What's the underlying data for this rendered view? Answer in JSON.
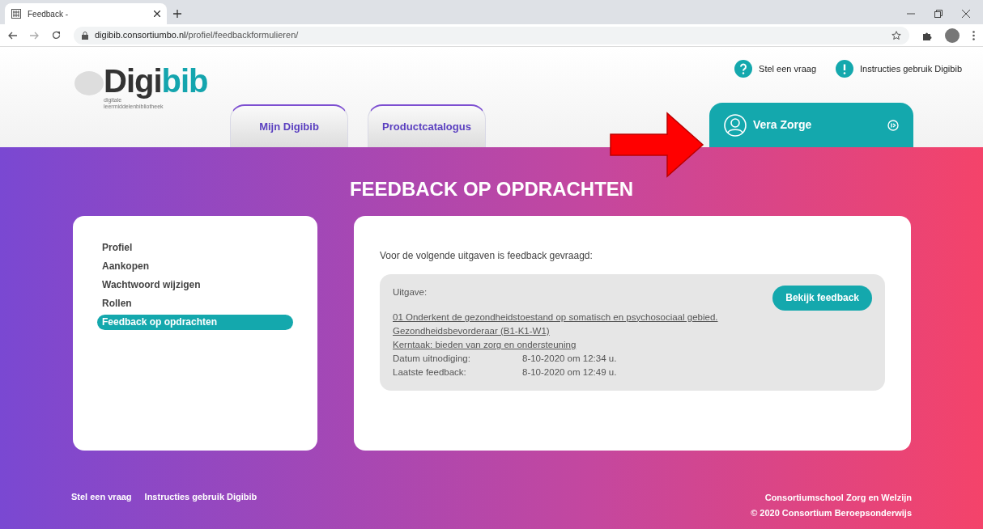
{
  "browser": {
    "tab_title": "Feedback -",
    "url_host": "digibib.consortiumbo.nl",
    "url_path": "/profiel/feedbackformulieren/"
  },
  "header": {
    "logo": {
      "dark": "Digi",
      "accent": "bib",
      "subtitle_1": "digitale",
      "subtitle_2": "leermiddelenbibliotheek"
    },
    "top_links": [
      {
        "kind": "question",
        "label": "Stel een vraag"
      },
      {
        "kind": "info",
        "label": "Instructies gebruik Digibib"
      }
    ],
    "tabs": [
      {
        "label": "Mijn Digibib",
        "selected": false
      },
      {
        "label": "Productcatalogus",
        "selected": false
      }
    ],
    "user": {
      "name": "Vera Zorge",
      "selected": true
    }
  },
  "page_title": "FEEDBACK OP OPDRACHTEN",
  "sidebar": {
    "items": [
      {
        "label": "Profiel",
        "selected": false
      },
      {
        "label": "Aankopen",
        "selected": false
      },
      {
        "label": "Wachtwoord wijzigen",
        "selected": false
      },
      {
        "label": "Rollen",
        "selected": false
      },
      {
        "label": "Feedback op opdrachten",
        "selected": true
      }
    ]
  },
  "content": {
    "intro": "Voor de volgende uitgaven is feedback gevraagd:",
    "items": [
      {
        "heading": "Uitgave:",
        "button": "Bekijk feedback",
        "links": [
          "01 Onderkent de gezondheidstoestand op somatisch en psychosociaal gebied.",
          "Gezondheidsbevorderaar (B1-K1-W1)",
          "Kerntaak: bieden van zorg en ondersteuning"
        ],
        "details": [
          {
            "label": "Datum uitnodiging:",
            "value": "8-10-2020 om 12:34 u."
          },
          {
            "label": "Laatste feedback:",
            "value": "8-10-2020 om 12:49 u."
          }
        ]
      }
    ]
  },
  "footer": {
    "links": [
      "Stel een vraag",
      "Instructies gebruik Digibib"
    ],
    "org": "Consortiumschool Zorg en Welzijn",
    "copyright": "© 2020 Consortium Beroepsonderwijs"
  }
}
